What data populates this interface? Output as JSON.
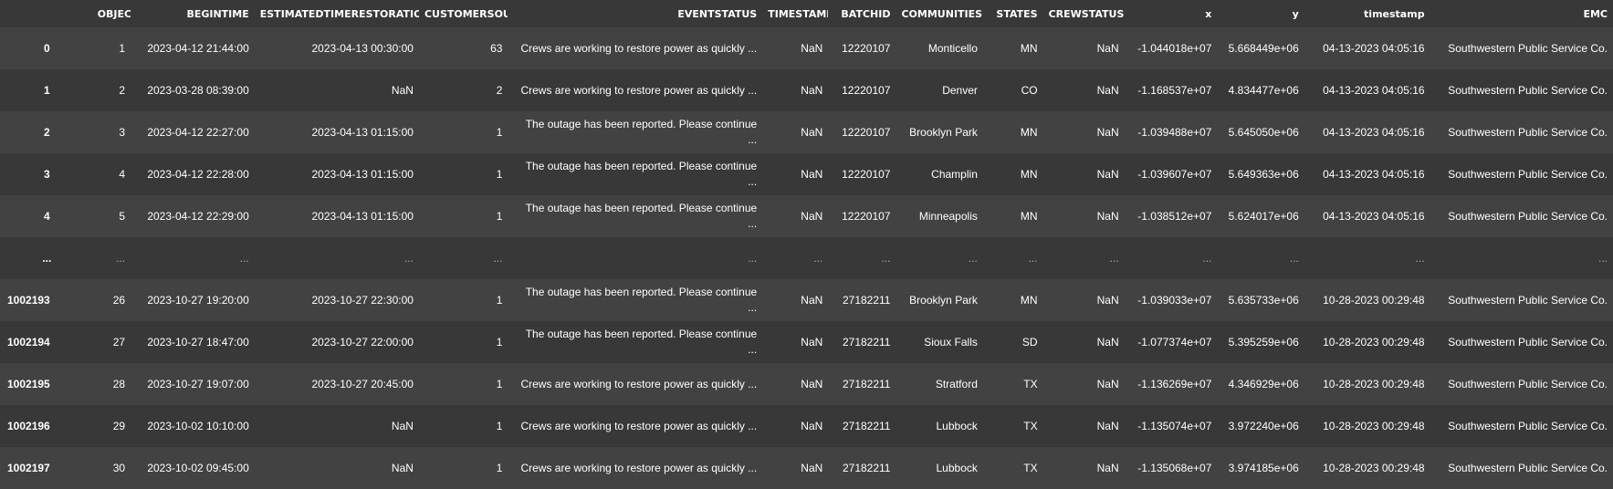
{
  "columns": [
    "",
    "OBJECTID",
    "BEGINTIME",
    "ESTIMATEDTIMERESTORATION",
    "CUSTOMERSOUT",
    "EVENTSTATUS",
    "TIMESTAMP",
    "BATCHID",
    "COMMUNITIES",
    "STATES",
    "CREWSTATUS",
    "x",
    "y",
    "timestamp",
    "EMC"
  ],
  "rows": [
    {
      "index": "0",
      "cells": [
        "1",
        "2023-04-12 21:44:00",
        "2023-04-13 00:30:00",
        "63",
        "Crews are working to restore power as quickly ...",
        "NaN",
        "12220107",
        "Monticello",
        "MN",
        "NaN",
        "-1.044018e+07",
        "5.668449e+06",
        "04-13-2023 04:05:16",
        "Southwestern Public Service Co."
      ]
    },
    {
      "index": "1",
      "cells": [
        "2",
        "2023-03-28 08:39:00",
        "NaN",
        "2",
        "Crews are working to restore power as quickly ...",
        "NaN",
        "12220107",
        "Denver",
        "CO",
        "NaN",
        "-1.168537e+07",
        "4.834477e+06",
        "04-13-2023 04:05:16",
        "Southwestern Public Service Co."
      ]
    },
    {
      "index": "2",
      "cells": [
        "3",
        "2023-04-12 22:27:00",
        "2023-04-13 01:15:00",
        "1",
        "The outage has been reported. Please continue ...",
        "NaN",
        "12220107",
        "Brooklyn Park",
        "MN",
        "NaN",
        "-1.039488e+07",
        "5.645050e+06",
        "04-13-2023 04:05:16",
        "Southwestern Public Service Co."
      ]
    },
    {
      "index": "3",
      "cells": [
        "4",
        "2023-04-12 22:28:00",
        "2023-04-13 01:15:00",
        "1",
        "The outage has been reported. Please continue ...",
        "NaN",
        "12220107",
        "Champlin",
        "MN",
        "NaN",
        "-1.039607e+07",
        "5.649363e+06",
        "04-13-2023 04:05:16",
        "Southwestern Public Service Co."
      ]
    },
    {
      "index": "4",
      "cells": [
        "5",
        "2023-04-12 22:29:00",
        "2023-04-13 01:15:00",
        "1",
        "The outage has been reported. Please continue ...",
        "NaN",
        "12220107",
        "Minneapolis",
        "MN",
        "NaN",
        "-1.038512e+07",
        "5.624017e+06",
        "04-13-2023 04:05:16",
        "Southwestern Public Service Co."
      ]
    },
    {
      "index": "...",
      "ellipsis": true,
      "cells": [
        "...",
        "...",
        "...",
        "...",
        "...",
        "...",
        "...",
        "...",
        "...",
        "...",
        "...",
        "...",
        "...",
        "..."
      ]
    },
    {
      "index": "1002193",
      "cells": [
        "26",
        "2023-10-27 19:20:00",
        "2023-10-27 22:30:00",
        "1",
        "The outage has been reported. Please continue ...",
        "NaN",
        "27182211",
        "Brooklyn Park",
        "MN",
        "NaN",
        "-1.039033e+07",
        "5.635733e+06",
        "10-28-2023 00:29:48",
        "Southwestern Public Service Co."
      ]
    },
    {
      "index": "1002194",
      "cells": [
        "27",
        "2023-10-27 18:47:00",
        "2023-10-27 22:00:00",
        "1",
        "The outage has been reported. Please continue ...",
        "NaN",
        "27182211",
        "Sioux Falls",
        "SD",
        "NaN",
        "-1.077374e+07",
        "5.395259e+06",
        "10-28-2023 00:29:48",
        "Southwestern Public Service Co."
      ]
    },
    {
      "index": "1002195",
      "cells": [
        "28",
        "2023-10-27 19:07:00",
        "2023-10-27 20:45:00",
        "1",
        "Crews are working to restore power as quickly ...",
        "NaN",
        "27182211",
        "Stratford",
        "TX",
        "NaN",
        "-1.136269e+07",
        "4.346929e+06",
        "10-28-2023 00:29:48",
        "Southwestern Public Service Co."
      ]
    },
    {
      "index": "1002196",
      "cells": [
        "29",
        "2023-10-02 10:10:00",
        "NaN",
        "1",
        "Crews are working to restore power as quickly ...",
        "NaN",
        "27182211",
        "Lubbock",
        "TX",
        "NaN",
        "-1.135074e+07",
        "3.972240e+06",
        "10-28-2023 00:29:48",
        "Southwestern Public Service Co."
      ]
    },
    {
      "index": "1002197",
      "cells": [
        "30",
        "2023-10-02 09:45:00",
        "NaN",
        "1",
        "Crews are working to restore power as quickly ...",
        "NaN",
        "27182211",
        "Lubbock",
        "TX",
        "NaN",
        "-1.135068e+07",
        "3.974185e+06",
        "10-28-2023 00:29:48",
        "Southwestern Public Service Co."
      ]
    }
  ]
}
